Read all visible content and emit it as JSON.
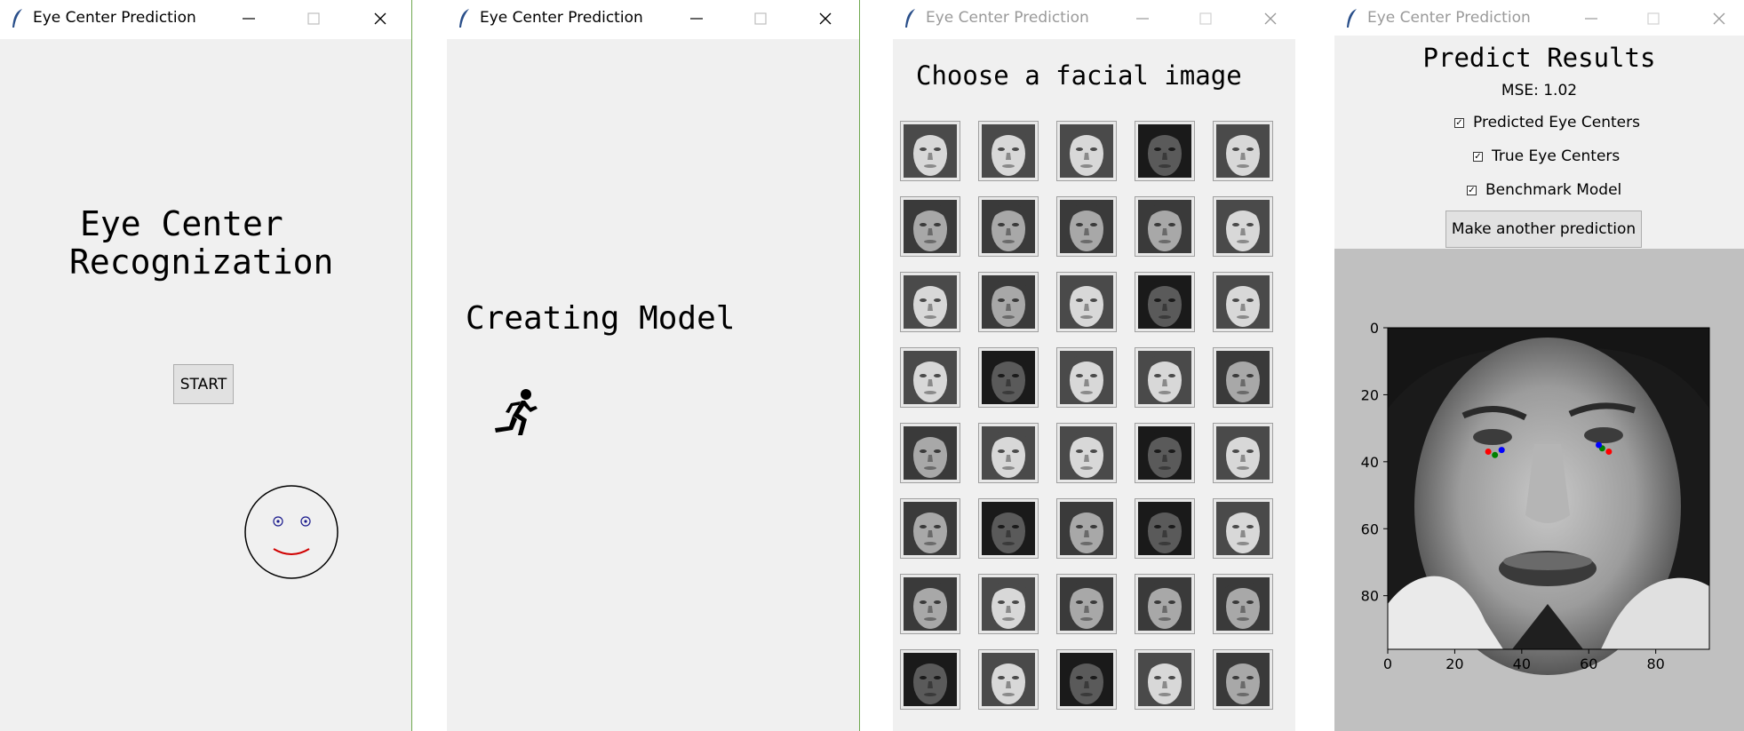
{
  "window_title": "Eye Center Prediction",
  "screen1": {
    "heading_line1": "Eye Center",
    "heading_line2": "Recognization",
    "start_label": "START"
  },
  "screen2": {
    "status": "Creating Model"
  },
  "screen3": {
    "heading": "Choose a facial image",
    "grid": {
      "rows": 8,
      "cols": 5
    },
    "tones": [
      [
        "light",
        "light",
        "light",
        "dark",
        "light"
      ],
      [
        "mid",
        "mid",
        "mid",
        "mid",
        "light"
      ],
      [
        "light",
        "mid",
        "light",
        "dark",
        "light"
      ],
      [
        "light",
        "dark",
        "light",
        "light",
        "mid"
      ],
      [
        "mid",
        "light",
        "light",
        "dark",
        "light"
      ],
      [
        "mid",
        "dark",
        "mid",
        "dark",
        "light"
      ],
      [
        "mid",
        "light",
        "mid",
        "mid",
        "mid"
      ],
      [
        "dark",
        "light",
        "dark",
        "light",
        "mid"
      ]
    ]
  },
  "screen4": {
    "heading": "Predict Results",
    "mse": "MSE: 1.02",
    "checks": [
      {
        "label": "Predicted Eye Centers",
        "checked": true
      },
      {
        "label": "True Eye Centers",
        "checked": true
      },
      {
        "label": "Benchmark Model",
        "checked": true
      }
    ],
    "another_label": "Make another prediction",
    "plot": {
      "xlim": [
        0,
        96
      ],
      "ylim": [
        96,
        0
      ],
      "xticks": [
        "0",
        "20",
        "40",
        "60",
        "80"
      ],
      "yticks": [
        "0",
        "20",
        "40",
        "60",
        "80"
      ],
      "xtick_values": [
        0,
        20,
        40,
        60,
        80
      ],
      "ytick_values": [
        0,
        20,
        40,
        60,
        80
      ],
      "markers": [
        {
          "series": "predicted",
          "color": "#ff0000",
          "points": [
            [
              30,
              37
            ],
            [
              66,
              37
            ]
          ]
        },
        {
          "series": "true",
          "color": "#008000",
          "points": [
            [
              32,
              38
            ],
            [
              64,
              36
            ]
          ]
        },
        {
          "series": "benchmark",
          "color": "#0000ff",
          "points": [
            [
              34,
              36.5
            ],
            [
              63,
              35
            ]
          ]
        }
      ]
    }
  },
  "colors": {
    "smile": "#d00000",
    "eye_dot": "#1a1a8c",
    "window_bg": "#f0f0f0",
    "plot_bg": "#c0c0c0"
  }
}
